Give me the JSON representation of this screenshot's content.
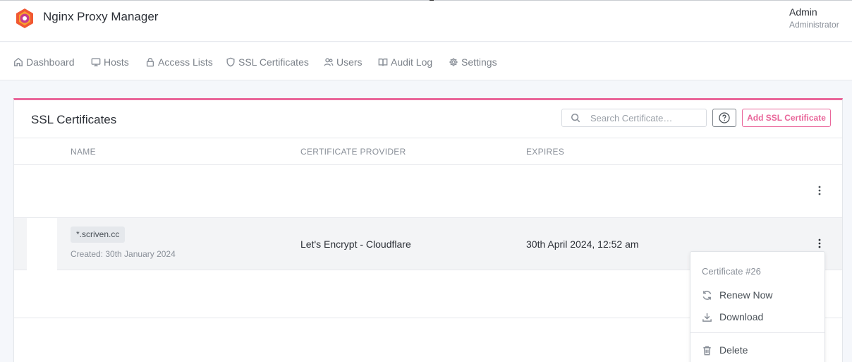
{
  "app": {
    "title": "Nginx Proxy Manager",
    "user_name": "Admin",
    "user_role": "Administrator"
  },
  "nav": {
    "items": [
      {
        "label": "Dashboard",
        "icon": "home-icon"
      },
      {
        "label": "Hosts",
        "icon": "monitor-icon"
      },
      {
        "label": "Access Lists",
        "icon": "lock-icon"
      },
      {
        "label": "SSL Certificates",
        "icon": "shield-icon"
      },
      {
        "label": "Users",
        "icon": "users-icon"
      },
      {
        "label": "Audit Log",
        "icon": "book-icon"
      },
      {
        "label": "Settings",
        "icon": "gear-icon"
      }
    ]
  },
  "page": {
    "title": "SSL Certificates",
    "search_placeholder": "Search Certificate…",
    "add_label": "Add SSL Certificate"
  },
  "table": {
    "columns": [
      "NAME",
      "CERTIFICATE PROVIDER",
      "EXPIRES"
    ],
    "rows": [
      {
        "domain": "*.scriven.cc",
        "created": "Created: 30th January 2024",
        "provider": "Let's Encrypt - Cloudflare",
        "expires": "30th April 2024, 12:52 am"
      }
    ]
  },
  "dropdown": {
    "header": "Certificate #26",
    "items": [
      {
        "label": "Renew Now",
        "icon": "refresh-icon"
      },
      {
        "label": "Download",
        "icon": "download-icon"
      },
      {
        "label": "Delete",
        "icon": "trash-icon"
      }
    ]
  },
  "colors": {
    "accent": "#e9669a",
    "logo_primary": "#f15833"
  }
}
